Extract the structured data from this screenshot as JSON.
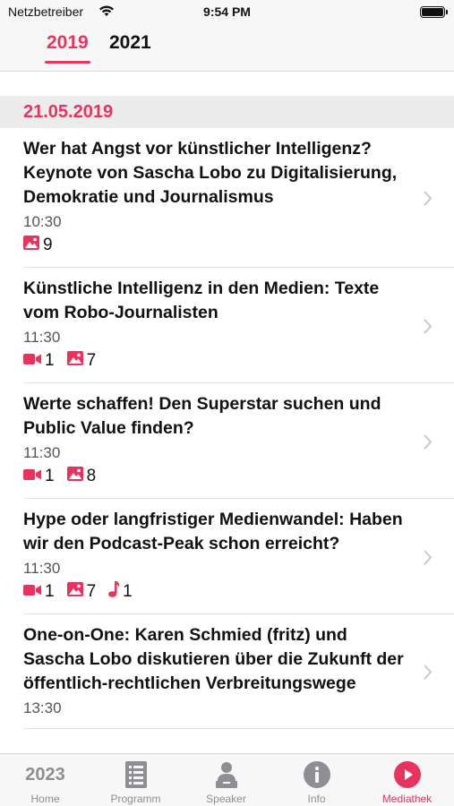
{
  "status_bar": {
    "carrier": "Netzbetreiber",
    "time": "9:54 PM",
    "battery_level": 1.0
  },
  "year_tabs": [
    {
      "label": "2019",
      "active": true
    },
    {
      "label": "2021",
      "active": false
    }
  ],
  "section": {
    "date": "21.05.2019"
  },
  "sessions": [
    {
      "title": "Wer hat Angst vor künstlicher Intelligenz? Keynote von Sascha Lobo zu Digitalisierung, Demokratie und Journalismus",
      "time": "10:30",
      "videos": null,
      "images": "9",
      "audio": null
    },
    {
      "title": "Künstliche Intelligenz in den Medien: Texte vom Robo-Journalisten",
      "time": "11:30",
      "videos": "1",
      "images": "7",
      "audio": null
    },
    {
      "title": "Werte schaffen! Den Superstar suchen und Public Value finden?",
      "time": "11:30",
      "videos": "1",
      "images": "8",
      "audio": null
    },
    {
      "title": "Hype oder langfristiger Medienwandel: Haben wir den Podcast-Peak schon erreicht?",
      "time": "11:30",
      "videos": "1",
      "images": "7",
      "audio": "1"
    },
    {
      "title": "One-on-One: Karen Schmied (fritz) und Sascha Lobo diskutieren über die Zukunft der öffentlich-rechtlichen Verbreitungswege",
      "time": "13:30",
      "videos": null,
      "images": null,
      "audio": null
    }
  ],
  "tab_bar": {
    "home_icon_text": "2023",
    "items": [
      {
        "label": "Home",
        "icon": "home-2023-icon",
        "active": false
      },
      {
        "label": "Programm",
        "icon": "list-icon",
        "active": false
      },
      {
        "label": "Speaker",
        "icon": "speaker-person-icon",
        "active": false
      },
      {
        "label": "Info",
        "icon": "info-icon",
        "active": false
      },
      {
        "label": "Mediathek",
        "icon": "play-icon",
        "active": true
      }
    ]
  },
  "colors": {
    "accent": "#e8335f",
    "inactive": "#8e8e93",
    "section_bg": "#ececec"
  }
}
